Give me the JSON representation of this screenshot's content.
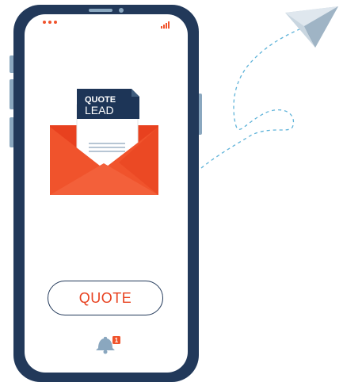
{
  "document": {
    "label_line1": "QUOTE",
    "label_line2": "LEAD"
  },
  "quote_button": {
    "label": "QUOTE"
  },
  "notification": {
    "count": "1"
  },
  "icons": {
    "status_dots": "more-dots-icon",
    "signal": "signal-bars-icon",
    "envelope": "envelope-icon",
    "bell": "bell-icon",
    "paper_plane": "paper-plane-icon"
  },
  "colors": {
    "phone_frame": "#22395a",
    "side_buttons": "#8aa7bf",
    "accent_orange": "#f0532c",
    "envelope_dark": "#e8411f",
    "document_label_bg": "#1d3557",
    "plane": "#9fb4c5",
    "flight_path": "#5fb3d9"
  }
}
